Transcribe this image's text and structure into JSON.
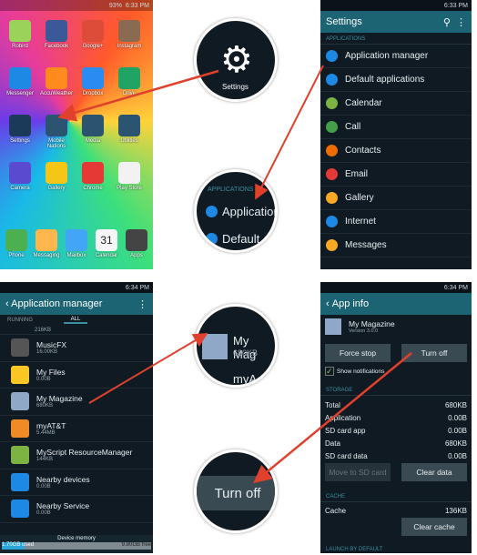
{
  "home": {
    "status_time": "6:33 PM",
    "battery": "93%",
    "apps": [
      {
        "label": "Robird",
        "color": "#9bd35a"
      },
      {
        "label": "Facebook",
        "color": "#3b5998"
      },
      {
        "label": "Google+",
        "color": "#dd4b39"
      },
      {
        "label": "Instagram",
        "color": "#8a6a50"
      },
      {
        "label": "Messenger",
        "color": "#1e88e5"
      },
      {
        "label": "AccuWeather",
        "color": "#ff8a1e"
      },
      {
        "label": "Dropbox",
        "color": "#2a8cf0"
      },
      {
        "label": "Drive",
        "color": "#1fa463"
      },
      {
        "label": "Settings",
        "color": "#1b3a5a"
      },
      {
        "label": "Mobile Nations",
        "color": "#2a5470"
      },
      {
        "label": "Media",
        "color": "#2a5470"
      },
      {
        "label": "Utilities",
        "color": "#2a5470"
      },
      {
        "label": "Camera",
        "color": "#5a4ad0"
      },
      {
        "label": "Gallery",
        "color": "#f5c518"
      },
      {
        "label": "Chrome",
        "color": "#e53935"
      },
      {
        "label": "Play Store",
        "color": "#f2f2f2"
      }
    ],
    "dock": [
      {
        "label": "Phone",
        "color": "#4caf50"
      },
      {
        "label": "Messaging",
        "color": "#ffb74d"
      },
      {
        "label": "Mailbox",
        "color": "#42a5f5"
      },
      {
        "label": "Calendar",
        "color": "#f5f5f5",
        "text": "31"
      },
      {
        "label": "Apps",
        "color": "#444"
      }
    ]
  },
  "settings": {
    "status_time": "6:33 PM",
    "title": "Settings",
    "section": "APPLICATIONS",
    "items": [
      {
        "label": "Application manager",
        "color": "#1e88e5"
      },
      {
        "label": "Default applications",
        "color": "#1e88e5"
      },
      {
        "label": "Calendar",
        "color": "#7cb342"
      },
      {
        "label": "Call",
        "color": "#43a047"
      },
      {
        "label": "Contacts",
        "color": "#ef6c00"
      },
      {
        "label": "Email",
        "color": "#e53935"
      },
      {
        "label": "Gallery",
        "color": "#f9a825"
      },
      {
        "label": "Internet",
        "color": "#1e88e5"
      },
      {
        "label": "Messages",
        "color": "#f9a825"
      }
    ]
  },
  "appmgr": {
    "status_time": "6:34 PM",
    "title": "Application manager",
    "tabs": [
      "RUNNING",
      "ALL"
    ],
    "partial_size": "216KB",
    "apps": [
      {
        "name": "MusicFX",
        "size": "16.00KB",
        "color": "#555"
      },
      {
        "name": "My Files",
        "size": "0.00B",
        "color": "#f9c623"
      },
      {
        "name": "My Magazine",
        "size": "680KB",
        "color": "#8fa8c8"
      },
      {
        "name": "myAT&T",
        "size": "5.44MB",
        "color": "#f08a24"
      },
      {
        "name": "MyScript ResourceManager",
        "size": "144KB",
        "color": "#7cb342"
      },
      {
        "name": "Nearby devices",
        "size": "0.00B",
        "color": "#1e88e5"
      },
      {
        "name": "Nearby Service",
        "size": "0.00B",
        "color": "#1e88e5"
      }
    ],
    "memory_label": "Device memory",
    "used": "1.70GB used",
    "free": "9.80GB free",
    "used_fraction": 0.15
  },
  "appinfo": {
    "status_time": "6:34 PM",
    "title": "App info",
    "app_name": "My Magazine",
    "version": "Version 3.0.0",
    "force_stop": "Force stop",
    "turn_off": "Turn off",
    "show_notifications": "Show notifications",
    "show_notifications_checked": true,
    "storage_label": "STORAGE",
    "storage": [
      {
        "k": "Total",
        "v": "680KB"
      },
      {
        "k": "Application",
        "v": "0.00B"
      },
      {
        "k": "SD card app",
        "v": "0.00B"
      },
      {
        "k": "Data",
        "v": "680KB"
      },
      {
        "k": "SD card data",
        "v": "0.00B"
      }
    ],
    "move_sd": "Move to SD card",
    "clear_data": "Clear data",
    "cache_label": "CACHE",
    "cache_key": "Cache",
    "cache_value": "136KB",
    "clear_cache": "Clear cache",
    "launch_label": "LAUNCH BY DEFAULT"
  },
  "callouts": {
    "settings": "Settings",
    "applications": "APPLICATIONS",
    "application": "Application",
    "default": "Default",
    "my_mag": "My Mag",
    "my_mag_size": "680KB",
    "myat": "myA",
    "turn_off": "Turn off"
  },
  "accent": "#e0412c"
}
